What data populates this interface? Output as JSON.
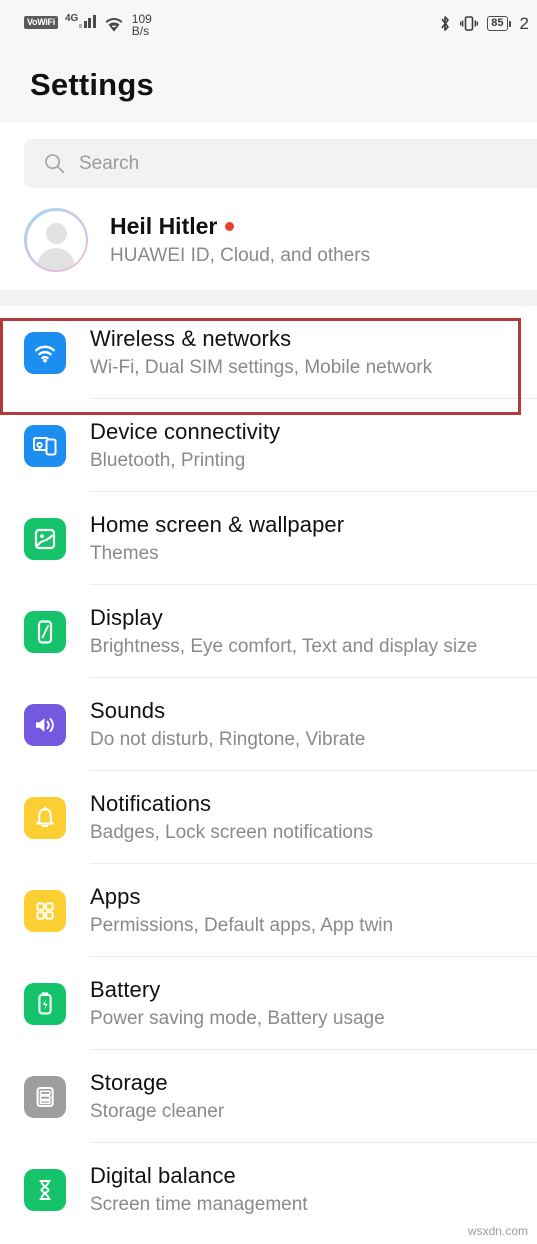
{
  "status_bar": {
    "volte_label": "VoWiFi",
    "network_type": "4G",
    "net_speed_value": "109",
    "net_speed_unit": "B/s",
    "battery_percent": "85",
    "clock_partial": "2",
    "icons": [
      "volte-icon",
      "signal-bars-icon",
      "wifi-icon",
      "bluetooth-icon",
      "vibrate-icon",
      "battery-icon"
    ]
  },
  "header": {
    "title": "Settings"
  },
  "search": {
    "placeholder": "Search",
    "icon": "search-icon"
  },
  "account": {
    "name": "Heil Hitler",
    "subtitle": "HUAWEI ID, Cloud, and others",
    "has_notification_dot": true,
    "avatar_icon": "person-avatar-icon"
  },
  "colors": {
    "blue": "#1c8ef0",
    "green": "#15c46a",
    "purple": "#7558e0",
    "yellow": "#fbcf32",
    "gray": "#9e9e9e",
    "highlight_red": "#b23a3a",
    "accent_dot": "#e8412b"
  },
  "settings_items": [
    {
      "title": "Wireless & networks",
      "subtitle": "Wi-Fi, Dual SIM settings, Mobile network",
      "icon": "wifi-icon",
      "icon_color": "#1c8ef0",
      "highlighted": true
    },
    {
      "title": "Device connectivity",
      "subtitle": "Bluetooth, Printing",
      "icon": "device-connect-icon",
      "icon_color": "#1c8ef0",
      "highlighted": false
    },
    {
      "title": "Home screen & wallpaper",
      "subtitle": "Themes",
      "icon": "image-icon",
      "icon_color": "#15c46a",
      "highlighted": false
    },
    {
      "title": "Display",
      "subtitle": "Brightness, Eye comfort, Text and display size",
      "icon": "phone-display-icon",
      "icon_color": "#15c46a",
      "highlighted": false
    },
    {
      "title": "Sounds",
      "subtitle": "Do not disturb, Ringtone, Vibrate",
      "icon": "speaker-icon",
      "icon_color": "#7558e0",
      "highlighted": false
    },
    {
      "title": "Notifications",
      "subtitle": "Badges, Lock screen notifications",
      "icon": "bell-icon",
      "icon_color": "#fbcf32",
      "highlighted": false
    },
    {
      "title": "Apps",
      "subtitle": "Permissions, Default apps, App twin",
      "icon": "grid-apps-icon",
      "icon_color": "#fbcf32",
      "highlighted": false
    },
    {
      "title": "Battery",
      "subtitle": "Power saving mode, Battery usage",
      "icon": "battery-icon",
      "icon_color": "#15c46a",
      "highlighted": false
    },
    {
      "title": "Storage",
      "subtitle": "Storage cleaner",
      "icon": "storage-icon",
      "icon_color": "#9e9e9e",
      "highlighted": false
    },
    {
      "title": "Digital balance",
      "subtitle": "Screen time management",
      "icon": "hourglass-icon",
      "icon_color": "#15c46a",
      "highlighted": false
    }
  ],
  "watermark": {
    "text": "wsxdn.com"
  }
}
